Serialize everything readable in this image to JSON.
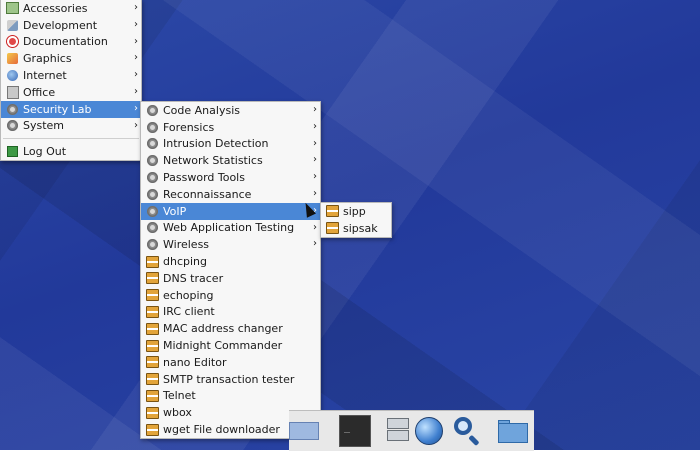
{
  "main_menu": {
    "items": [
      {
        "label": "Accessories",
        "icon": "accessories-icon",
        "submenu": true
      },
      {
        "label": "Development",
        "icon": "development-icon",
        "submenu": true
      },
      {
        "label": "Documentation",
        "icon": "documentation-icon",
        "submenu": true
      },
      {
        "label": "Graphics",
        "icon": "graphics-icon",
        "submenu": true
      },
      {
        "label": "Internet",
        "icon": "internet-icon",
        "submenu": true
      },
      {
        "label": "Office",
        "icon": "office-icon",
        "submenu": true
      },
      {
        "label": "Security Lab",
        "icon": "gear-icon",
        "submenu": true,
        "highlighted": true
      },
      {
        "label": "System",
        "icon": "system-icon",
        "submenu": true
      }
    ],
    "logout_label": "Log Out"
  },
  "security_menu": {
    "items": [
      {
        "label": "Code Analysis",
        "submenu": true
      },
      {
        "label": "Forensics",
        "submenu": true
      },
      {
        "label": "Intrusion Detection",
        "submenu": true
      },
      {
        "label": "Network Statistics",
        "submenu": true
      },
      {
        "label": "Password Tools",
        "submenu": true
      },
      {
        "label": "Reconnaissance",
        "submenu": true
      },
      {
        "label": "VoIP",
        "submenu": true,
        "highlighted": true
      },
      {
        "label": "Web Application Testing",
        "submenu": true
      },
      {
        "label": "Wireless",
        "submenu": true
      },
      {
        "label": "dhcping"
      },
      {
        "label": "DNS tracer"
      },
      {
        "label": "echoping"
      },
      {
        "label": "IRC client"
      },
      {
        "label": "MAC address changer"
      },
      {
        "label": "Midnight Commander"
      },
      {
        "label": "nano Editor"
      },
      {
        "label": "SMTP transaction tester"
      },
      {
        "label": "Telnet"
      },
      {
        "label": "wbox"
      },
      {
        "label": "wget File downloader"
      }
    ]
  },
  "voip_menu": {
    "items": [
      {
        "label": "sipp"
      },
      {
        "label": "sipsak"
      }
    ]
  },
  "colors": {
    "highlight": "#4a87d6",
    "desktop": "#2a44a3",
    "menu_bg": "#f7f7f7"
  },
  "panel": {
    "launchers": [
      "terminal-icon",
      "file-cabinet-icon",
      "web-browser-icon",
      "search-icon",
      "folder-icon"
    ]
  }
}
